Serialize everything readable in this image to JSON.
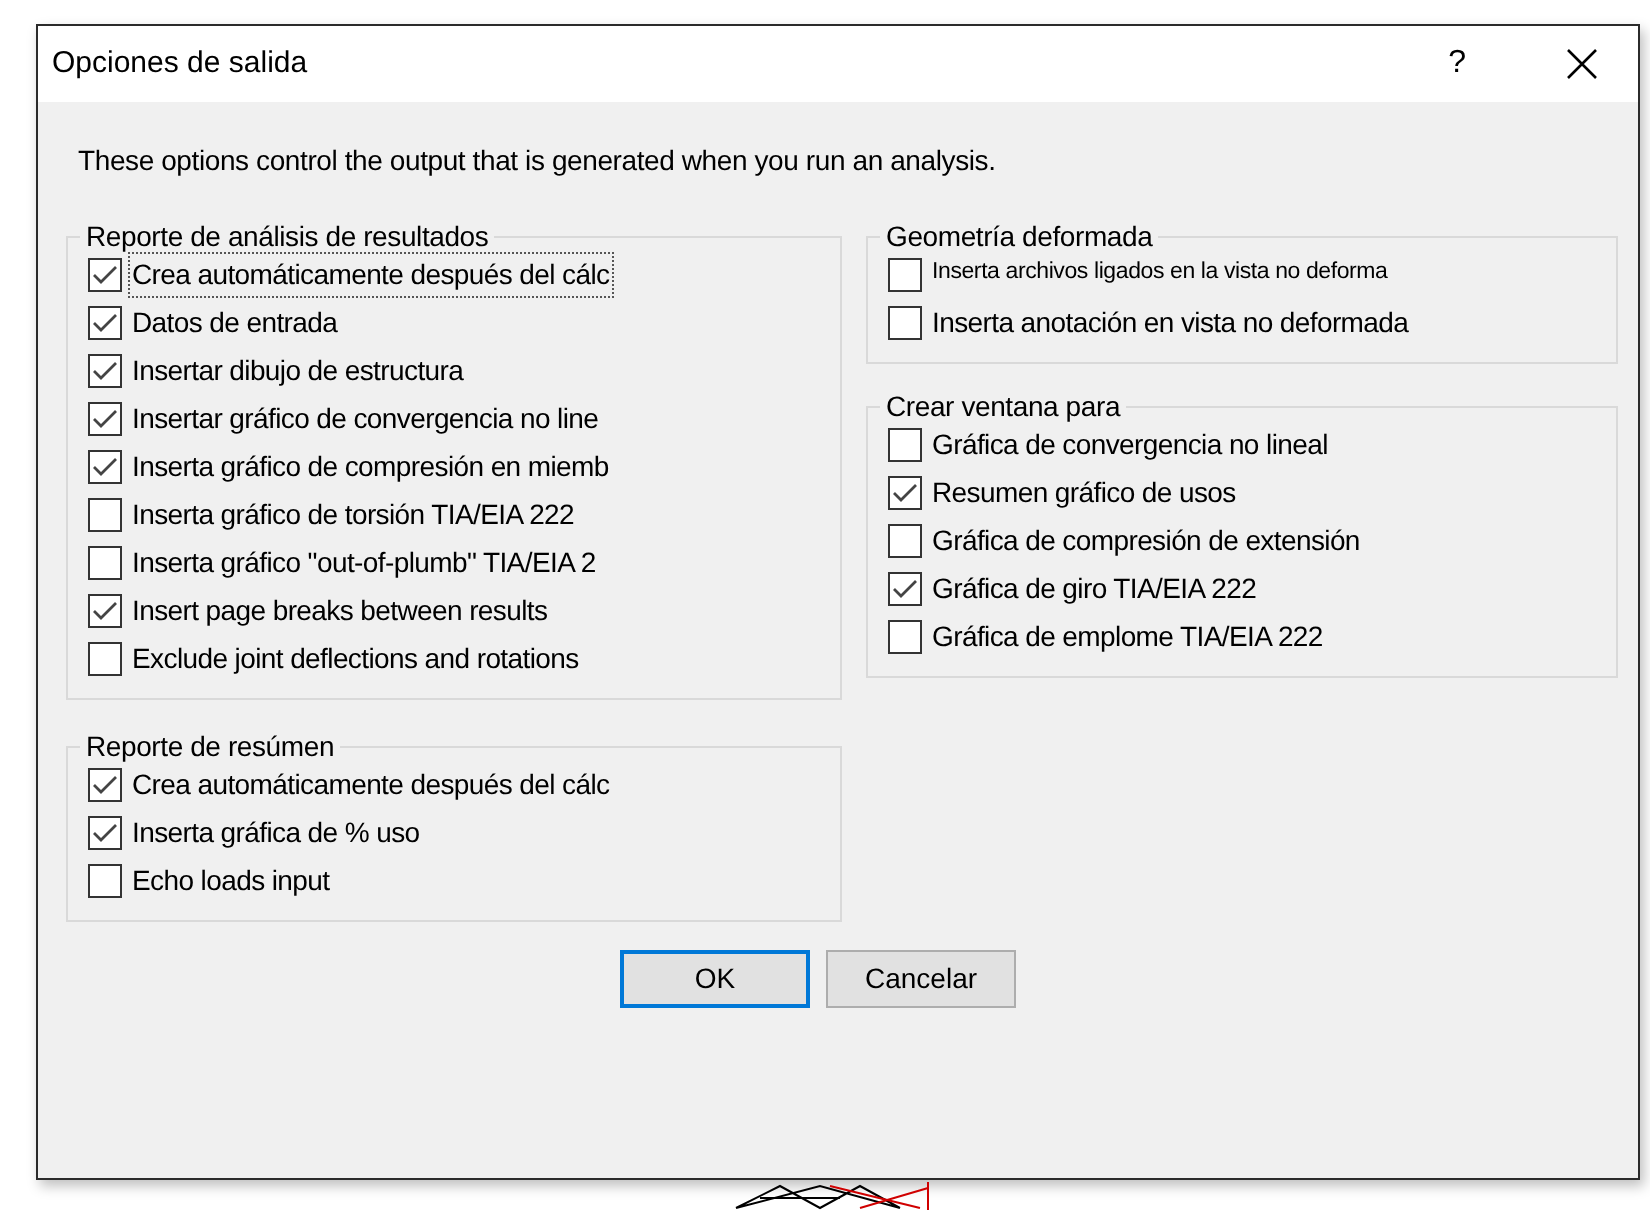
{
  "window": {
    "title": "Opciones de salida",
    "help": "?"
  },
  "description": "These options control the output that is generated when you run an analysis.",
  "left_groups": [
    {
      "title": "Reporte de análisis de resultados",
      "items": [
        {
          "label": "Crea automáticamente después del cálc",
          "checked": true,
          "focused": true
        },
        {
          "label": "Datos de entrada",
          "checked": true,
          "focused": false
        },
        {
          "label": "Insertar dibujo de estructura",
          "checked": true,
          "focused": false
        },
        {
          "label": "Insertar gráfico de convergencia no line",
          "checked": true,
          "focused": false
        },
        {
          "label": "Inserta gráfico de compresión en miemb",
          "checked": true,
          "focused": false
        },
        {
          "label": "Inserta gráfico de torsión TIA/EIA 222",
          "checked": false,
          "focused": false
        },
        {
          "label": "Inserta gráfico \"out-of-plumb\" TIA/EIA 2",
          "checked": false,
          "focused": false
        },
        {
          "label": "Insert page breaks between results",
          "checked": true,
          "focused": false
        },
        {
          "label": "Exclude joint deflections and rotations",
          "checked": false,
          "focused": false
        }
      ]
    },
    {
      "title": "Reporte de resúmen",
      "items": [
        {
          "label": "Crea automáticamente después del cálc",
          "checked": true
        },
        {
          "label": "Inserta gráfica de % uso",
          "checked": true
        },
        {
          "label": "Echo loads input",
          "checked": false
        }
      ]
    }
  ],
  "right_groups": [
    {
      "title": "Geometría deformada",
      "items": [
        {
          "label": "Inserta archivos ligados en la vista no deforma",
          "checked": false,
          "kind": "small"
        },
        {
          "label": "Inserta anotación en vista no deformada",
          "checked": false,
          "kind": "normal"
        }
      ]
    },
    {
      "title": "Crear ventana para",
      "items": [
        {
          "label": "Gráfica de convergencia no lineal",
          "checked": false
        },
        {
          "label": "Resumen gráfico de usos",
          "checked": true
        },
        {
          "label": "Gráfica de compresión de extensión",
          "checked": false
        },
        {
          "label": "Gráfica de giro TIA/EIA 222",
          "checked": true
        },
        {
          "label": "Gráfica de emplome TIA/EIA 222",
          "checked": false
        }
      ]
    }
  ],
  "buttons": [
    {
      "label": "OK",
      "default": true
    },
    {
      "label": "Cancelar",
      "default": false
    }
  ]
}
